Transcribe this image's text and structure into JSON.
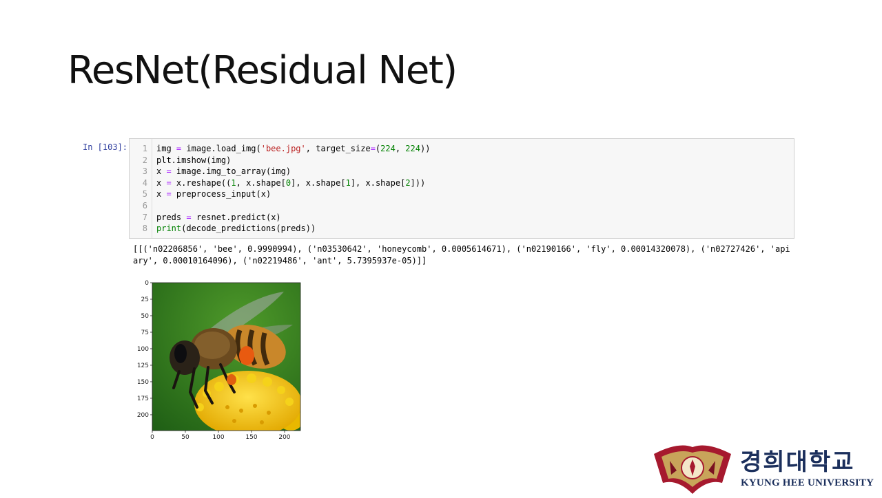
{
  "slide": {
    "title": "ResNet(Residual Net)"
  },
  "notebook": {
    "prompt": "In [103]:",
    "code_lines": [
      {
        "n": "1",
        "tokens": [
          [
            "img ",
            ""
          ],
          [
            "=",
            "op"
          ],
          [
            " image.load_img(",
            ""
          ],
          [
            "'bee.jpg'",
            "str"
          ],
          [
            ", target_size",
            ""
          ],
          [
            "=",
            "op"
          ],
          [
            "(",
            ""
          ],
          [
            "224",
            "num"
          ],
          [
            ", ",
            ""
          ],
          [
            "224",
            "num"
          ],
          [
            "))",
            ""
          ]
        ]
      },
      {
        "n": "2",
        "tokens": [
          [
            "plt.imshow(img)",
            ""
          ]
        ]
      },
      {
        "n": "3",
        "tokens": [
          [
            "x ",
            ""
          ],
          [
            "=",
            "op"
          ],
          [
            " image.img_to_array(img)",
            ""
          ]
        ]
      },
      {
        "n": "4",
        "tokens": [
          [
            "x ",
            ""
          ],
          [
            "=",
            "op"
          ],
          [
            " x.reshape((",
            ""
          ],
          [
            "1",
            "num"
          ],
          [
            ", x.shape[",
            ""
          ],
          [
            "0",
            "num"
          ],
          [
            "], x.shape[",
            ""
          ],
          [
            "1",
            "num"
          ],
          [
            "], x.shape[",
            ""
          ],
          [
            "2",
            "num"
          ],
          [
            "]))",
            ""
          ]
        ]
      },
      {
        "n": "5",
        "tokens": [
          [
            "x ",
            ""
          ],
          [
            "=",
            "op"
          ],
          [
            " preprocess_input(x)",
            ""
          ]
        ]
      },
      {
        "n": "6",
        "tokens": [
          [
            "",
            ""
          ]
        ]
      },
      {
        "n": "7",
        "tokens": [
          [
            "preds ",
            ""
          ],
          [
            "=",
            "op"
          ],
          [
            " resnet.predict(x)",
            ""
          ]
        ]
      },
      {
        "n": "8",
        "tokens": [
          [
            "print",
            "builtin"
          ],
          [
            "(decode_predictions(preds))",
            ""
          ]
        ]
      }
    ],
    "output_text": "[[('n02206856', 'bee', 0.9990994), ('n03530642', 'honeycomb', 0.0005614671), ('n02190166', 'fly', 0.00014320078), ('n02727426', 'apiary', 0.00010164096), ('n02219486', 'ant', 5.7395937e-05)]]"
  },
  "plot": {
    "image_subject": "bee on yellow flower",
    "y_ticks": [
      "0",
      "25",
      "50",
      "75",
      "100",
      "125",
      "150",
      "175",
      "200"
    ],
    "x_ticks": [
      "0",
      "50",
      "100",
      "150",
      "200"
    ],
    "colors": {
      "background_green": "#2f7d1f",
      "flower_yellow": "#f2c400"
    }
  },
  "logo": {
    "korean": "경희대학교",
    "english": "KYUNG HEE UNIVERSITY",
    "colors": {
      "emblem_red": "#a6192e",
      "text_navy": "#1b2f5c"
    }
  }
}
